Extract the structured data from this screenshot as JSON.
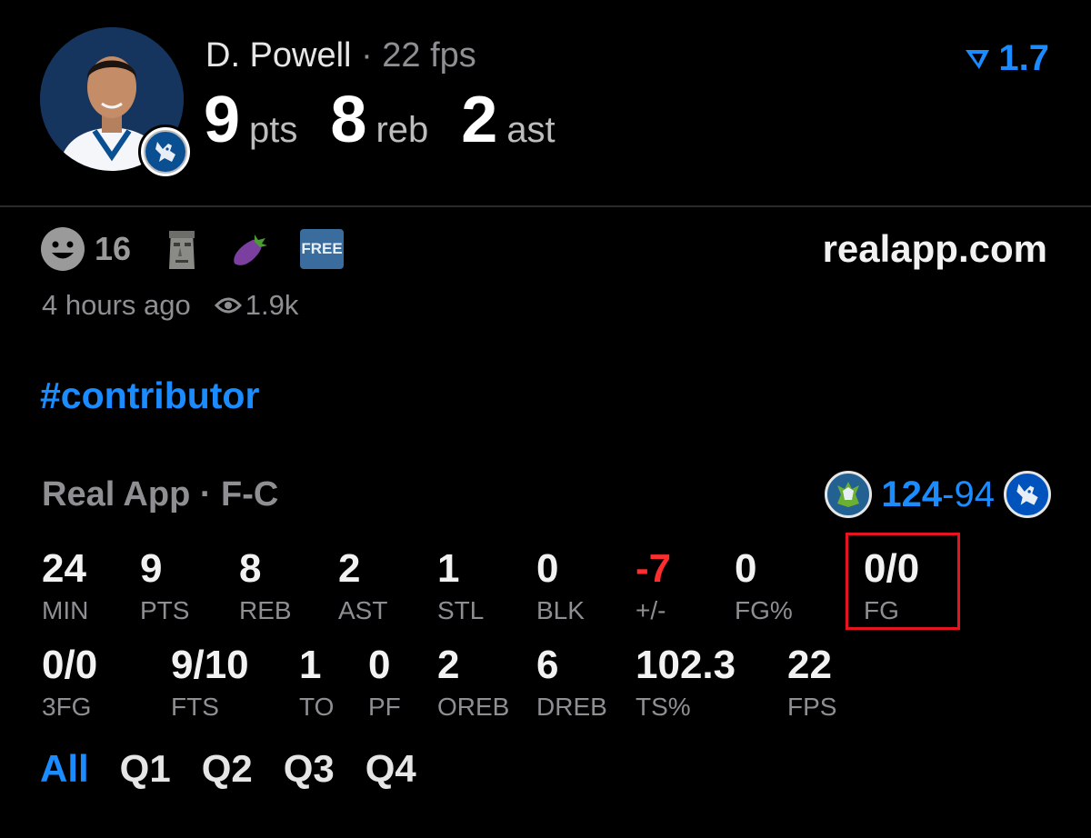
{
  "player": {
    "name": "D. Powell",
    "separator": "·",
    "fps_text": "22 fps",
    "photo_icon": "player-headshot",
    "team_badge_icon": "mavericks-logo"
  },
  "headline": [
    {
      "value": "9",
      "unit": "pts"
    },
    {
      "value": "8",
      "unit": "reb"
    },
    {
      "value": "2",
      "unit": "ast"
    }
  ],
  "rating": {
    "value": "1.7",
    "icon": "real-app-logo",
    "color": "#1a8cff"
  },
  "reactions": {
    "smile_count": "16",
    "icons": [
      "smile-emoji",
      "moai-emoji",
      "eggplant-emoji",
      "free-button-emoji"
    ],
    "free_label": "FREE"
  },
  "site": "realapp.com",
  "meta": {
    "time_ago": "4 hours ago",
    "views": "1.9k"
  },
  "hashtag": "#contributor",
  "source": "Real App · F-C",
  "game": {
    "team_left_icon": "timberwolves-logo",
    "score_win": "124",
    "score_dash": "-",
    "score_lose": "94",
    "team_right_icon": "mavericks-logo"
  },
  "stats_row1": [
    {
      "value": "24",
      "label": "MIN"
    },
    {
      "value": "9",
      "label": "PTS"
    },
    {
      "value": "8",
      "label": "REB"
    },
    {
      "value": "2",
      "label": "AST"
    },
    {
      "value": "1",
      "label": "STL"
    },
    {
      "value": "0",
      "label": "BLK"
    },
    {
      "value": "-7",
      "label": "+/-"
    },
    {
      "value": "0",
      "label": "FG%"
    },
    {
      "value": "0/0",
      "label": "FG"
    }
  ],
  "stats_row2": [
    {
      "value": "0/0",
      "label": "3FG"
    },
    {
      "value": "9/10",
      "label": "FTS"
    },
    {
      "value": "1",
      "label": "TO"
    },
    {
      "value": "0",
      "label": "PF"
    },
    {
      "value": "2",
      "label": "OREB"
    },
    {
      "value": "6",
      "label": "DREB"
    },
    {
      "value": "102.3",
      "label": "TS%"
    },
    {
      "value": "22",
      "label": "FPS"
    }
  ],
  "periods": [
    "All",
    "Q1",
    "Q2",
    "Q3",
    "Q4"
  ],
  "active_period": "All",
  "colors": {
    "accent": "#1a8cff",
    "negative": "#ff2d2d",
    "highlight": "#e5141e",
    "muted": "#8e8e93"
  }
}
